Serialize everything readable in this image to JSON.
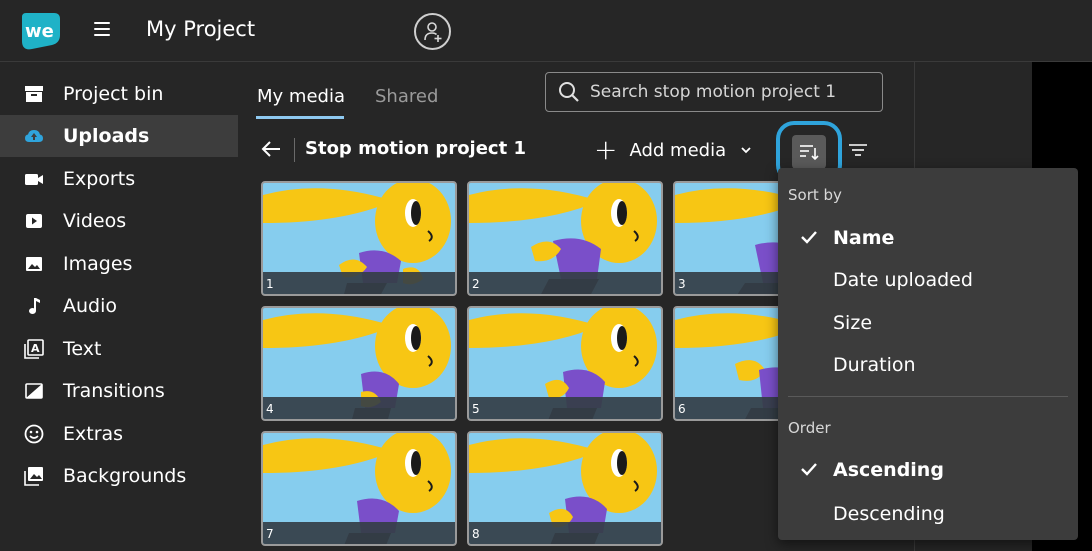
{
  "header": {
    "logo_text": "we",
    "project_title": "My Project"
  },
  "sidebar": {
    "items": [
      {
        "label": "Project bin",
        "icon": "archive-icon"
      },
      {
        "label": "Uploads",
        "icon": "cloud-upload-icon",
        "active": true
      },
      {
        "label": "Exports",
        "icon": "camera-icon"
      },
      {
        "label": "Videos",
        "icon": "play-icon"
      },
      {
        "label": "Images",
        "icon": "image-icon"
      },
      {
        "label": "Audio",
        "icon": "music-note-icon"
      },
      {
        "label": "Text",
        "icon": "text-icon"
      },
      {
        "label": "Transitions",
        "icon": "transition-icon"
      },
      {
        "label": "Extras",
        "icon": "smiley-icon"
      },
      {
        "label": "Backgrounds",
        "icon": "backgrounds-icon"
      }
    ]
  },
  "main": {
    "tabs": [
      {
        "label": "My media",
        "active": true
      },
      {
        "label": "Shared",
        "active": false
      }
    ],
    "search": {
      "placeholder": "Search stop motion project 1"
    },
    "folder_title": "Stop motion project 1",
    "add_media_label": "Add media",
    "thumbnails": [
      "1",
      "2",
      "3",
      "4",
      "5",
      "6",
      "7",
      "8"
    ]
  },
  "sort_menu": {
    "sort_by_heading": "Sort by",
    "sort_by_options": [
      "Name",
      "Date uploaded",
      "Size",
      "Duration"
    ],
    "sort_by_selected": "Name",
    "order_heading": "Order",
    "order_options": [
      "Ascending",
      "Descending"
    ],
    "order_selected": "Ascending"
  },
  "colors": {
    "accent": "#2fa4dc",
    "tab_underline": "#8ec9f0",
    "thumb_sky": "#86cdee",
    "character_yellow": "#f7c614",
    "character_purple": "#7a4fc9"
  }
}
